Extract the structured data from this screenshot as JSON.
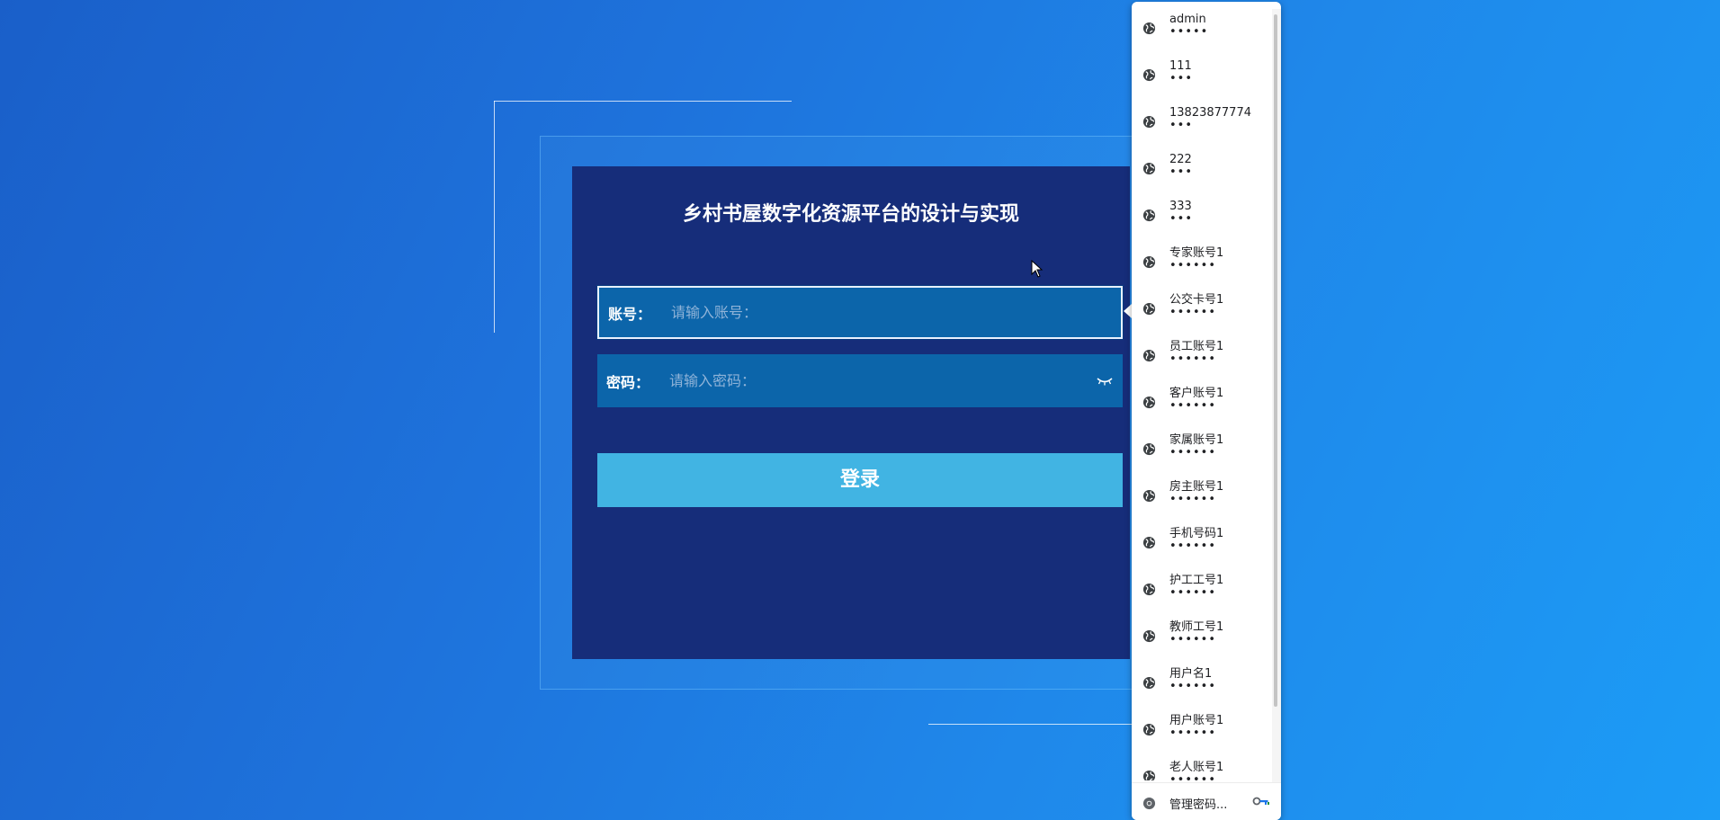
{
  "login": {
    "title": "乡村书屋数字化资源平台的设计与实现",
    "account_label": "账号：",
    "account_placeholder": "请输入账号：",
    "password_label": "密码：",
    "password_placeholder": "请输入密码：",
    "login_button": "登录"
  },
  "colors": {
    "panel": "#162d7a",
    "field": "#0c65aa",
    "button": "#41b4e3"
  },
  "autofill": {
    "items": [
      {
        "username": "admin",
        "password_mask": "•••••"
      },
      {
        "username": "111",
        "password_mask": "•••"
      },
      {
        "username": "13823877774",
        "password_mask": "•••"
      },
      {
        "username": "222",
        "password_mask": "•••"
      },
      {
        "username": "333",
        "password_mask": "•••"
      },
      {
        "username": "专家账号1",
        "password_mask": "••••••"
      },
      {
        "username": "公交卡号1",
        "password_mask": "••••••"
      },
      {
        "username": "员工账号1",
        "password_mask": "••••••"
      },
      {
        "username": "客户账号1",
        "password_mask": "••••••"
      },
      {
        "username": "家属账号1",
        "password_mask": "••••••"
      },
      {
        "username": "房主账号1",
        "password_mask": "••••••"
      },
      {
        "username": "手机号码1",
        "password_mask": "••••••"
      },
      {
        "username": "护工工号1",
        "password_mask": "••••••"
      },
      {
        "username": "教师工号1",
        "password_mask": "••••••"
      },
      {
        "username": "用户名1",
        "password_mask": "••••••"
      },
      {
        "username": "用户账号1",
        "password_mask": "••••••"
      },
      {
        "username": "老人账号1",
        "password_mask": "••••••"
      }
    ],
    "footer_label": "管理密码...",
    "item_icon": "globe-icon",
    "footer_icon": "chrome-icon",
    "footer_right_icon": "key-icon"
  }
}
